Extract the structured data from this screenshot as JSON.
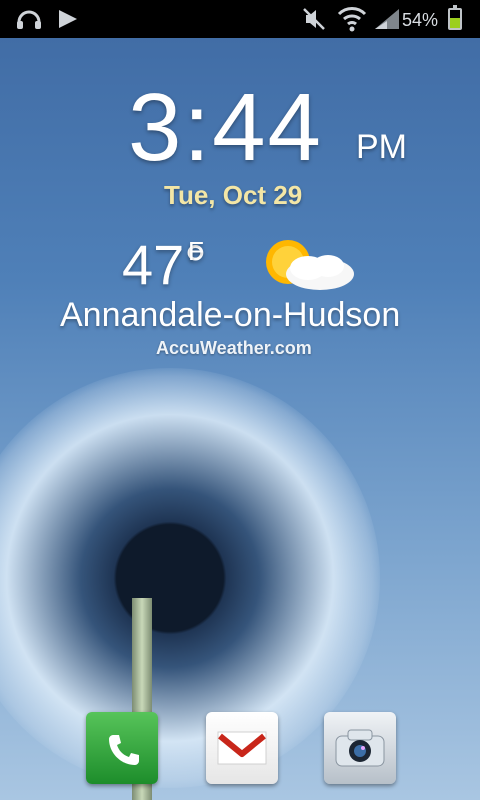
{
  "status_bar": {
    "left_icons": [
      "headphones-icon",
      "play-icon"
    ],
    "right_icons": [
      "mute-icon",
      "wifi-icon",
      "signal-icon"
    ],
    "battery_percent_text": "54%",
    "battery_level": 0.54
  },
  "home_widget": {
    "time": "3:44",
    "ampm": "PM",
    "date": "Tue, Oct 29",
    "temperature": "47°",
    "temperature_unit": "F",
    "location": "Annandale-on-Hudson",
    "provider": "AccuWeather.com",
    "weather_icon": "partly-cloudy-icon"
  },
  "dock": {
    "apps": [
      {
        "name": "phone-app",
        "icon": "phone-icon"
      },
      {
        "name": "gmail-app",
        "icon": "gmail-icon"
      },
      {
        "name": "camera-app",
        "icon": "camera-icon"
      }
    ]
  }
}
